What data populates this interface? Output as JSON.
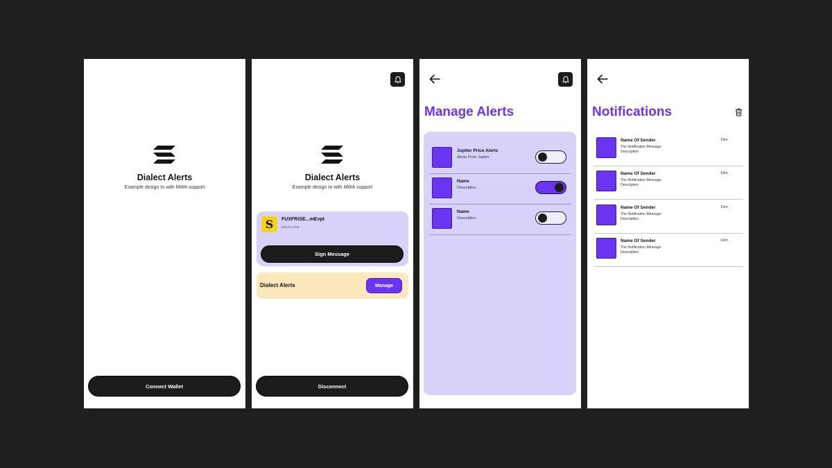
{
  "colors": {
    "background": "#1f1f1f",
    "accent": "#6b34f2",
    "lavender": "#d8d2fb",
    "cream": "#fbe9bd",
    "dark": "#1c1c1c"
  },
  "screen1": {
    "logo_icon": "solana-logo-icon",
    "title": "Dialect Alerts",
    "subtitle": "Example design to with MWA support",
    "connect_label": "Connect Wallet"
  },
  "screen2": {
    "bell_icon": "bell-icon",
    "logo_icon": "solana-logo-icon",
    "title": "Dialect Alerts",
    "subtitle": "Example design to with MWA support",
    "wallet": {
      "avatar_letter": "S",
      "address": "FUXFRiSE...mEvpt",
      "network": "SOLFLARE"
    },
    "sign_label": "Sign Message",
    "alerts_card": {
      "label": "Dialect Alerts",
      "manage_label": "Manage"
    },
    "disconnect_label": "Disconnect"
  },
  "screen3": {
    "back_icon": "arrow-left-icon",
    "bell_icon": "bell-icon",
    "heading": "Manage Alerts",
    "alerts": [
      {
        "name": "Jupiter Price Alerts",
        "description": "Alerts From Jupiter",
        "enabled": false
      },
      {
        "name": "Name",
        "description": "Description",
        "enabled": true
      },
      {
        "name": "Name",
        "description": "Description",
        "enabled": false
      }
    ]
  },
  "screen4": {
    "back_icon": "arrow-left-icon",
    "trash_icon": "trash-icon",
    "heading": "Notifications",
    "notifications": [
      {
        "sender": "Name Of Sender",
        "message": "The Notification Message",
        "description": "Description",
        "time": "10m"
      },
      {
        "sender": "Name Of Sender",
        "message": "The Notification Message",
        "description": "Description",
        "time": "10m"
      },
      {
        "sender": "Name Of Sender",
        "message": "The Notification Message",
        "description": "Description",
        "time": "10m"
      },
      {
        "sender": "Name Of Sender",
        "message": "The Notification Message",
        "description": "Description",
        "time": "10m"
      }
    ]
  }
}
